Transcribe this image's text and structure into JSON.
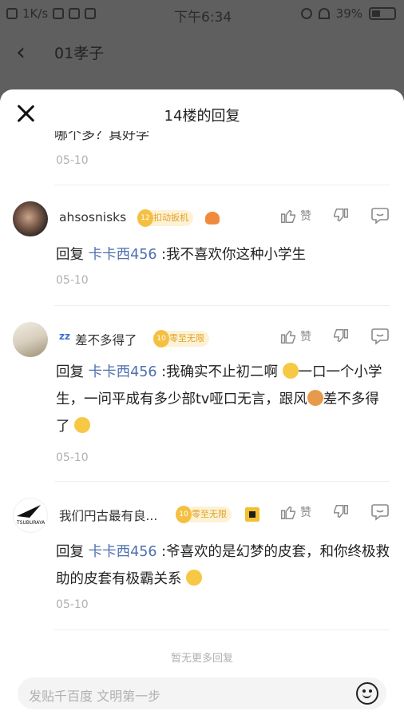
{
  "status_bar": {
    "speed": "1K/s",
    "time": "下午6:34",
    "battery": "39%"
  },
  "page": {
    "title": "01孝子"
  },
  "sheet": {
    "title": "14楼的回复",
    "partial_text": "哪个多？真好学",
    "partial_date": "05-10",
    "no_more": "暂无更多回复",
    "input_placeholder": "发贴千百度 文明第一步"
  },
  "replies": [
    {
      "username": "ahsosnisks",
      "badge_level": "12",
      "badge_text": "扣动扳机",
      "like_label": "赞",
      "reply_label": "回复",
      "at_user": "卡卡西456",
      "text": ":我不喜欢你这种小学生",
      "date": "05-10"
    },
    {
      "username": "差不多得了",
      "badge_level": "10",
      "badge_text": "零至无限",
      "like_label": "赞",
      "reply_label": "回复",
      "at_user": "卡卡西456",
      "text_a": ":我确实不止初二啊",
      "text_b": "一口一个小学生，一问平成有多少部tv哑口无言，跟风",
      "text_c": "差不多得了",
      "date": "05-10"
    },
    {
      "username": "我们円古最有良...",
      "badge_level": "10",
      "badge_text": "零至无限",
      "like_label": "赞",
      "reply_label": "回复",
      "at_user": "卡卡西456",
      "text": ":爷喜欢的是幻梦的皮套，和你终极救助的皮套有极霸关系",
      "date": "05-10"
    }
  ],
  "colors": {
    "overlay": "#5f5f5f",
    "link": "#4e6fb0",
    "date": "#b0b0b0",
    "badge_bg": "#fdf2d6",
    "badge_fg": "#e0a120"
  }
}
